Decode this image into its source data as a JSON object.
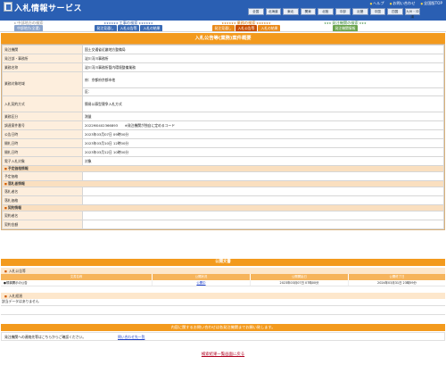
{
  "header": {
    "title": "入札情報サービス",
    "links": [
      "ヘルプ",
      "お問い合わせ",
      "全国版TOP"
    ],
    "regions": [
      "全国",
      "北海道",
      "東北",
      "関東",
      "北陸",
      "中部",
      "近畿",
      "中国",
      "四国",
      "九州・沖縄"
    ]
  },
  "search_nav": [
    {
      "label": "中部地方の検索",
      "buttons": [
        "中部地方(全選)"
      ]
    },
    {
      "label": "工事の検索",
      "buttons": [
        "発注見通し",
        "入札公告等",
        "入札の結果"
      ]
    },
    {
      "label": "業務の検索",
      "buttons": [
        "発注見通し",
        "入札公告等",
        "入札の結果"
      ]
    },
    {
      "label": "発注機関の検索",
      "buttons": [
        "発注機関情報"
      ]
    }
  ],
  "detail": {
    "title": "入札公告等(業務)案件概要",
    "rows": [
      {
        "label": "発注機関",
        "value": "国土交通省近畿地方整備局"
      },
      {
        "label": "発注部・事務所",
        "value": "淀川河川事務所"
      },
      {
        "label": "業務名称",
        "value": "淀川河川事務所管内環境整備業務"
      },
      {
        "label": "業務対象地域",
        "value": "府：京都府京都市他",
        "value2": "区："
      },
      {
        "label": "入札契約方式",
        "value": "簡易公募型競争入札方式"
      },
      {
        "label": "業務区分",
        "value": "測量"
      },
      {
        "label": "調達案件番号",
        "value": "2022M0402366893　　※発注機関が独自に定めるコード"
      },
      {
        "label": "公告日時",
        "value": "2023年03月07日 09時00分"
      },
      {
        "label": "開札日時",
        "value": "2023年03月10日 12時00分"
      },
      {
        "label": "開札日時",
        "value": "2023年03月12日 10時00分"
      },
      {
        "label": "電子入札対象",
        "value": "対象"
      }
    ],
    "sections": {
      "price": {
        "title": "予定価格情報",
        "rows": [
          {
            "label": "予定価格",
            "value": ""
          }
        ]
      },
      "winner": {
        "title": "落札者情報",
        "rows": [
          {
            "label": "落札者名",
            "value": ""
          },
          {
            "label": "落札価格",
            "value": ""
          }
        ]
      },
      "contract": {
        "title": "契約情報",
        "rows": [
          {
            "label": "契約者名",
            "value": ""
          },
          {
            "label": "契約金額",
            "value": ""
          }
        ]
      }
    }
  },
  "public_docs": {
    "title": "公開文書",
    "sub_title": "入札公告等",
    "columns": [
      "文書名称",
      "公開状況",
      "公開開始日",
      "公開終了日"
    ],
    "rows": [
      {
        "name": "●規構開示の公告",
        "status": "公開中",
        "start": "2023年03月07日 07時00分",
        "end": "2024年03月31日 23時59分"
      }
    ],
    "result_title": "入札経過",
    "result_empty": "該当データはありません"
  },
  "contact": {
    "bar": "内容に関するお問い合わせは各発注機関までお願い致します。",
    "text": "発注機関への連絡先等はこちらからご確認ください。",
    "link": "問い合わせ先一覧"
  },
  "back_link": "検索結果一覧画面に戻る"
}
